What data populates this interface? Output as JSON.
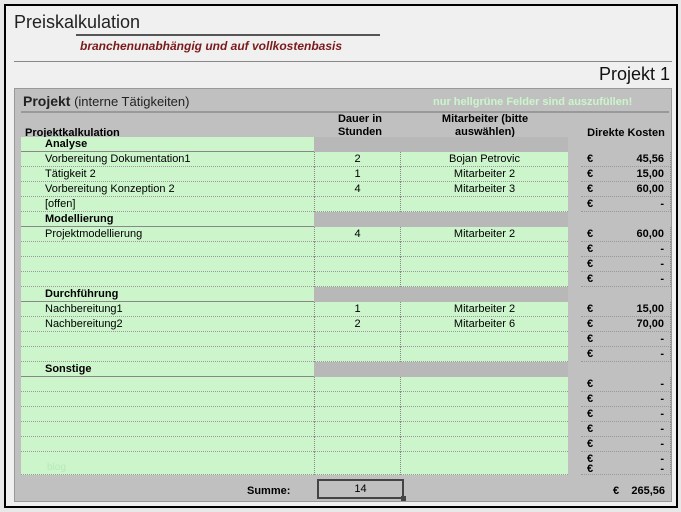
{
  "header": {
    "title": "Preiskalkulation",
    "subtitle": "branchenunabhängig und auf vollkostenbasis",
    "project_name": "Projekt 1"
  },
  "panel": {
    "title": "Projekt",
    "title_note": "(interne Tätigkeiten)",
    "hint": "nur hellgrüne Felder sind auszufüllen!",
    "hint_color": "#ccf5cc"
  },
  "columns": {
    "name": "Projektkalkulation",
    "duration": "Dauer in Stunden",
    "employee": "Mitarbeiter (bitte auswählen)",
    "cost": "Direkte Kosten"
  },
  "currency": "€",
  "sections": [
    {
      "name": "Analyse",
      "rows": [
        {
          "task": "Vorbereitung Dokumentation1",
          "hours": "2",
          "employee": "Bojan Petrovic",
          "cost": "45,56"
        },
        {
          "task": "Tätigkeit 2",
          "hours": "1",
          "employee": "Mitarbeiter 2",
          "cost": "15,00"
        },
        {
          "task": "Vorbereitung Konzeption 2",
          "hours": "4",
          "employee": "Mitarbeiter 3",
          "cost": "60,00"
        },
        {
          "task": "[offen]",
          "hours": "",
          "employee": "",
          "cost": "-"
        }
      ]
    },
    {
      "name": "Modellierung",
      "rows": [
        {
          "task": "Projektmodellierung",
          "hours": "4",
          "employee": "Mitarbeiter 2",
          "cost": "60,00"
        },
        {
          "task": "",
          "hours": "",
          "employee": "",
          "cost": "-"
        },
        {
          "task": "",
          "hours": "",
          "employee": "",
          "cost": "-"
        },
        {
          "task": "",
          "hours": "",
          "employee": "",
          "cost": "-"
        }
      ]
    },
    {
      "name": "Durchführung",
      "rows": [
        {
          "task": "Nachbereitung1",
          "hours": "1",
          "employee": "Mitarbeiter 2",
          "cost": "15,00"
        },
        {
          "task": "Nachbereitung2",
          "hours": "2",
          "employee": "Mitarbeiter 6",
          "cost": "70,00"
        },
        {
          "task": "",
          "hours": "",
          "employee": "",
          "cost": "-"
        },
        {
          "task": "",
          "hours": "",
          "employee": "",
          "cost": "-"
        }
      ]
    },
    {
      "name": "Sonstige",
      "rows": [
        {
          "task": "",
          "hours": "",
          "employee": "",
          "cost": "-"
        },
        {
          "task": "",
          "hours": "",
          "employee": "",
          "cost": "-"
        },
        {
          "task": "",
          "hours": "",
          "employee": "",
          "cost": "-"
        },
        {
          "task": "",
          "hours": "",
          "employee": "",
          "cost": "-"
        },
        {
          "task": "",
          "hours": "",
          "employee": "",
          "cost": "-"
        },
        {
          "task": "",
          "hours": "",
          "employee": "",
          "cost": "-"
        },
        {
          "task": "",
          "hours": "",
          "employee": "",
          "cost": "-"
        }
      ]
    }
  ],
  "watermark": "blog",
  "summary": {
    "label": "Summe:",
    "hours_total": "14",
    "cost_total": "265,56"
  }
}
